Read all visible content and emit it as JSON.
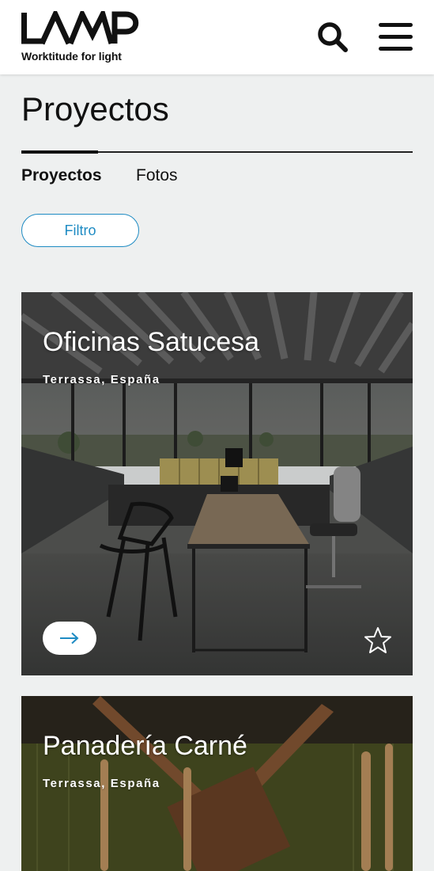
{
  "header": {
    "logo_text": "LAMP",
    "logo_tagline": "Worktitude for light",
    "search_icon": "search-icon",
    "menu_icon": "hamburger-menu-icon"
  },
  "page": {
    "title": "Proyectos"
  },
  "tabs": [
    {
      "label": "Proyectos",
      "active": true
    },
    {
      "label": "Fotos",
      "active": false
    }
  ],
  "filter": {
    "label": "Filtro"
  },
  "projects": [
    {
      "title": "Oficinas Satucesa",
      "location": "Terrassa, España",
      "arrow_icon": "arrow-right-icon",
      "favorite_icon": "star-outline-icon"
    },
    {
      "title": "Panadería Carné",
      "location": "Terrassa, España"
    }
  ],
  "colors": {
    "accent": "#1e8bc3",
    "background": "#eef0f0",
    "header_bg": "#ffffff"
  }
}
